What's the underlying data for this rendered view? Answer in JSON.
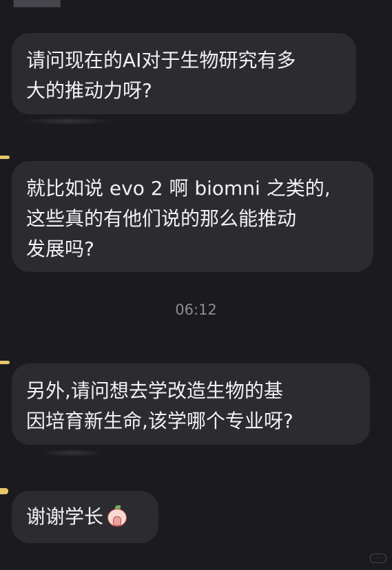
{
  "messages": [
    {
      "lines": [
        "请问现在的AI对于生物研究有多",
        "大的推动力呀?"
      ]
    },
    {
      "lines": [
        "就比如说 evo 2 啊 biomni 之类的,",
        "这些真的有他们说的那么能推动",
        "发展吗?"
      ]
    },
    {
      "lines": [
        "另外,请问想去学改造生物的基",
        "因培育新生命,该学哪个专业呀?"
      ]
    },
    {
      "text": "谢谢学长",
      "emoji": "praying-emoji-icon"
    }
  ],
  "timestamp": "06:12",
  "colors": {
    "background": "#1b1a1f",
    "bubble": "#2c2c30",
    "text": "#f2f2f4",
    "timestamp": "#8d8c94",
    "accent": "#e9c56a"
  }
}
